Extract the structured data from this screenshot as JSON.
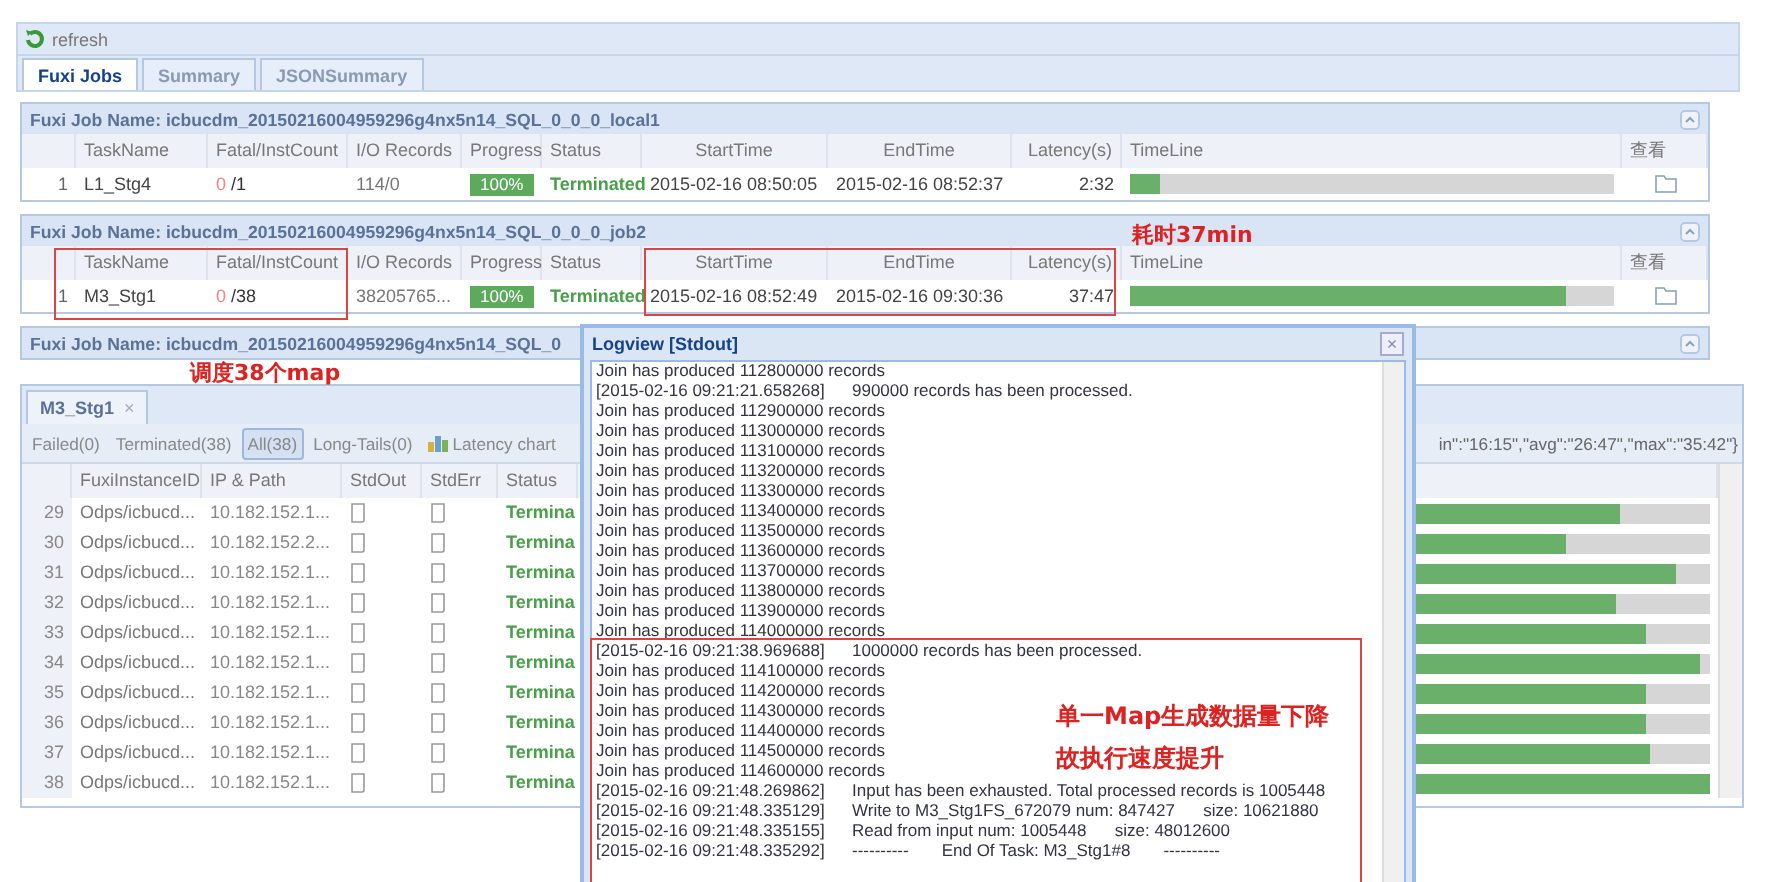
{
  "toolbar": {
    "label": "refresh"
  },
  "tabs": [
    {
      "label": "Fuxi Jobs",
      "selected": true
    },
    {
      "label": "Summary",
      "selected": false
    },
    {
      "label": "JSONSummary",
      "selected": false
    }
  ],
  "jobs": [
    {
      "title": "Fuxi Job Name: icbucdm_20150216004959296g4nx5n14_SQL_0_0_0_local1",
      "columns": [
        "TaskName",
        "Fatal/InstCount",
        "I/O Records",
        "Progress",
        "Status",
        "StartTime",
        "EndTime",
        "Latency(s)",
        "TimeLine",
        "查看"
      ],
      "rows": [
        {
          "index": "1",
          "task": "L1_Stg4",
          "fatal": "0",
          "count": "/1",
          "io": "114/0",
          "progress": "100%",
          "status": "Terminated",
          "start": "2015-02-16 08:50:05",
          "end": "2015-02-16 08:52:37",
          "latency": "2:32",
          "level": 0.06
        }
      ]
    },
    {
      "title": "Fuxi Job Name: icbucdm_20150216004959296g4nx5n14_SQL_0_0_0_job2",
      "columns": [
        "TaskName",
        "Fatal/InstCount",
        "I/O Records",
        "Progress",
        "Status",
        "StartTime",
        "EndTime",
        "Latency(s)",
        "TimeLine",
        "查看"
      ],
      "rows": [
        {
          "index": "1",
          "task": "M3_Stg1",
          "fatal": "0",
          "count": "/38",
          "io": "38205765...",
          "progress": "100%",
          "status": "Terminated",
          "start": "2015-02-16 08:52:49",
          "end": "2015-02-16 09:30:36",
          "latency": "37:47",
          "level": 0.9
        }
      ]
    },
    {
      "title": "Fuxi Job Name: icbucdm_20150216004959296g4nx5n14_SQL_0"
    }
  ],
  "detail": {
    "tab": "M3_Stg1",
    "close": "×",
    "filters": [
      {
        "label": "Failed(0)",
        "selected": false,
        "kind": "text"
      },
      {
        "label": "Terminated(38)",
        "selected": false,
        "kind": "text"
      },
      {
        "label": "All(38)",
        "selected": true,
        "kind": "text"
      },
      {
        "label": "Long-Tails(0)",
        "selected": false,
        "kind": "text"
      },
      {
        "label": "Latency chart",
        "selected": false,
        "kind": "chart"
      }
    ],
    "stats": "in\":\"16:15\",\"avg\":\"26:47\",\"max\":\"35:42\"}",
    "columns": [
      "FuxiInstanceID",
      "IP & Path",
      "StdOut",
      "StdErr",
      "Status"
    ],
    "rows": [
      {
        "index": "29",
        "instance": "Odps/icbucd...",
        "ip": "10.182.152.1...",
        "status": "Termina",
        "level": 0.82
      },
      {
        "index": "30",
        "instance": "Odps/icbucd...",
        "ip": "10.182.152.2...",
        "status": "Termina",
        "level": 0.71
      },
      {
        "index": "31",
        "instance": "Odps/icbucd...",
        "ip": "10.182.152.1...",
        "status": "Termina",
        "level": 0.93
      },
      {
        "index": "32",
        "instance": "Odps/icbucd...",
        "ip": "10.182.152.1...",
        "status": "Termina",
        "level": 0.81
      },
      {
        "index": "33",
        "instance": "Odps/icbucd...",
        "ip": "10.182.152.1...",
        "status": "Termina",
        "level": 0.87
      },
      {
        "index": "34",
        "instance": "Odps/icbucd...",
        "ip": "10.182.152.1...",
        "status": "Termina",
        "level": 0.98
      },
      {
        "index": "35",
        "instance": "Odps/icbucd...",
        "ip": "10.182.152.1...",
        "status": "Termina",
        "level": 0.87
      },
      {
        "index": "36",
        "instance": "Odps/icbucd...",
        "ip": "10.182.152.1...",
        "status": "Termina",
        "level": 0.87
      },
      {
        "index": "37",
        "instance": "Odps/icbucd...",
        "ip": "10.182.152.1...",
        "status": "Termina",
        "level": 0.88
      },
      {
        "index": "38",
        "instance": "Odps/icbucd...",
        "ip": "10.182.152.1...",
        "status": "Termina",
        "level": 1
      }
    ]
  },
  "logview": {
    "title": "Logview [Stdout]",
    "close": "×",
    "lines": [
      {
        "text": "Join has produced 112800000 records"
      },
      {
        "stamp": "[2015-02-16 09:21:21.658268]",
        "text": "990000 records has been processed."
      },
      {
        "text": "Join has produced 112900000 records"
      },
      {
        "text": "Join has produced 113000000 records"
      },
      {
        "text": "Join has produced 113100000 records"
      },
      {
        "text": "Join has produced 113200000 records"
      },
      {
        "text": "Join has produced 113300000 records"
      },
      {
        "text": "Join has produced 113400000 records"
      },
      {
        "text": "Join has produced 113500000 records"
      },
      {
        "text": "Join has produced 113600000 records"
      },
      {
        "text": "Join has produced 113700000 records"
      },
      {
        "text": "Join has produced 113800000 records"
      },
      {
        "text": "Join has produced 113900000 records"
      },
      {
        "text": "Join has produced 114000000 records"
      },
      {
        "stamp": "[2015-02-16 09:21:38.969688]",
        "text": "1000000 records has been processed."
      },
      {
        "text": "Join has produced 114100000 records"
      },
      {
        "text": "Join has produced 114200000 records"
      },
      {
        "text": "Join has produced 114300000 records"
      },
      {
        "text": "Join has produced 114400000 records"
      },
      {
        "text": "Join has produced 114500000 records"
      },
      {
        "text": "Join has produced 114600000 records"
      },
      {
        "stamp": "[2015-02-16 09:21:48.269862]",
        "text": "Input has been exhausted. Total processed records is 1005448"
      },
      {
        "stamp": "[2015-02-16 09:21:48.335129]",
        "text": "Write to M3_Stg1FS_672079 num: 847427      size: 10621880"
      },
      {
        "stamp": "[2015-02-16 09:21:48.335155]",
        "text": "Read from input num: 1005448      size: 48012600"
      },
      {
        "stamp": "[2015-02-16 09:21:48.335292]",
        "text": "----------       End Of Task: M3_Stg1#8       ----------"
      }
    ]
  },
  "annotations": {
    "latency": "耗时37min",
    "maps": "调度38个map",
    "log": [
      "单一Map生成数据量下降",
      "故执行速度提升"
    ]
  }
}
